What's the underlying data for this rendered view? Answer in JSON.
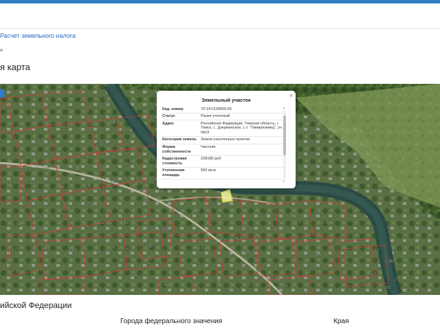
{
  "header": {
    "link_label": "Расчет земельного налога",
    "breadcrumb": "я",
    "page_title": "я карта"
  },
  "map": {
    "popup": {
      "title": "Земельный участок",
      "close_label": "×",
      "rows": [
        {
          "key": "Кад. номер",
          "value": "70:14:0129005:55"
        },
        {
          "key": "Статус",
          "value": "Ранее учтенный"
        },
        {
          "key": "Адрес",
          "value": "Российская Федерация, Томская область, г. Томск, с. Дзержинское, с.т. \"Тимирязевец\", уч. №23"
        },
        {
          "key": "Категория земель",
          "value": "Земли населенных пунктов"
        },
        {
          "key": "Форма собственности",
          "value": "Частная"
        },
        {
          "key": "Кадастровая стоимость",
          "value": "228180 руб"
        },
        {
          "key": "Уточненная площадь",
          "value": "500 кв.м"
        }
      ]
    },
    "labels": [
      "219",
      "74",
      "175",
      "69",
      "49",
      "113",
      "154",
      "32",
      "78",
      "46",
      "53",
      "21",
      "33",
      "19",
      "57",
      "67",
      "44",
      "119",
      "129",
      "161",
      "138",
      "52",
      "26",
      "37",
      "90",
      "86",
      "48",
      "111",
      "81",
      "10",
      "93",
      "110",
      "127",
      "87",
      "66",
      "140",
      "177",
      "42",
      "161",
      "81",
      "51",
      "49",
      "129",
      "119",
      "56",
      "46",
      "35",
      "32",
      "78",
      "42",
      "55",
      "48",
      "71",
      "175",
      "215",
      "88",
      "4340",
      "1360",
      "36",
      "99",
      "122",
      "248",
      "314",
      "142",
      "315",
      "50",
      "422",
      "52",
      "17",
      "140",
      "54",
      "92",
      "36",
      "39",
      "21",
      "56",
      "13",
      "78",
      "61",
      "57",
      "122",
      "43",
      "10",
      "45",
      "13",
      "138",
      "14",
      "181",
      "122",
      "14",
      "15",
      "16",
      "21",
      "215",
      "48",
      "17",
      "20",
      "14",
      "17",
      "5",
      "6",
      "2",
      "33",
      "50"
    ]
  },
  "footer": {
    "section_title": "ийской Федерации",
    "col1": "Города федерального значения",
    "col2": "Края"
  }
}
